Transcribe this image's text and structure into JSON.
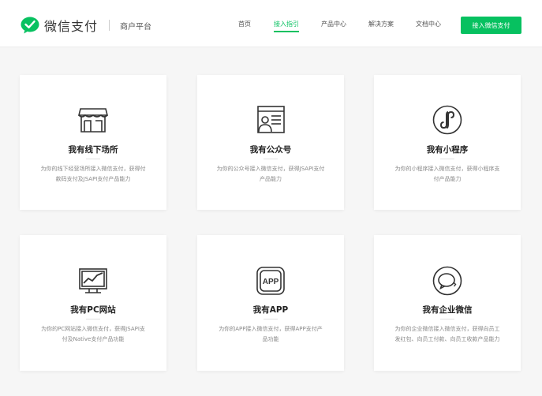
{
  "header": {
    "brand": "微信支付",
    "subtitle": "商户平台",
    "nav": [
      "首页",
      "接入指引",
      "产品中心",
      "解决方案",
      "文档中心"
    ],
    "active_nav": "接入指引",
    "cta": "接入微信支付"
  },
  "cards": [
    {
      "icon": "storefront-icon",
      "title": "我有线下场所",
      "desc": "为你的线下经营场所接入微信支付，获得付款码支付及JSAPI支付产品能力"
    },
    {
      "icon": "official-account-icon",
      "title": "我有公众号",
      "desc": "为你的公众号接入微信支付，获得JSAPI支付产品能力"
    },
    {
      "icon": "mini-program-icon",
      "title": "我有小程序",
      "desc": "为你的小程序接入微信支付，获得小程序支付产品能力"
    },
    {
      "icon": "pc-website-icon",
      "title": "我有PC网站",
      "desc": "为你的PC网站接入微信支付，获得JSAPI支付及Native支付产品功能"
    },
    {
      "icon": "app-icon",
      "title": "我有APP",
      "desc": "为你的APP接入微信支付，获得APP支付产品功能"
    },
    {
      "icon": "wecom-icon",
      "title": "我有企业微信",
      "desc": "为你的企业微信接入微信支付，获得向员工发红包、向员工付款、向员工收款产品能力"
    }
  ],
  "colors": {
    "accent": "#07c160",
    "background": "#f6f6f6"
  }
}
